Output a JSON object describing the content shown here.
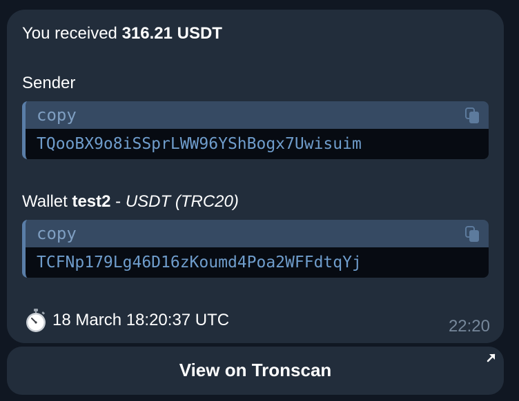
{
  "message": {
    "received_prefix": "You received ",
    "received_amount": "316.21 USDT",
    "sender_label": "Sender",
    "sender_block": {
      "lang": "copy",
      "address": "TQooBX9o8iSSprLWW96YShBogx7Uwisuim"
    },
    "wallet_prefix": "Wallet ",
    "wallet_name": "test2",
    "wallet_sep": " - ",
    "wallet_network": "USDT (TRC20)",
    "wallet_block": {
      "lang": "copy",
      "address": "TCFNp179Lg46D16zKoumd4Poa2WFFdtqYj"
    },
    "timestamp_text": " 18 March 18:20:37 UTC",
    "sent_time": "22:20",
    "icons": [
      "stopwatch-icon",
      "copy-icon",
      "external-link-arrow-icon"
    ]
  },
  "button": {
    "label": "View on Tronscan"
  },
  "colors": {
    "bubble": "#222d3b",
    "background": "#101722",
    "code_header": "#364a63",
    "code_body": "#070b12",
    "code_text": "#6f9dcc",
    "code_accent": "#5a7ea8",
    "time": "#76879a"
  }
}
